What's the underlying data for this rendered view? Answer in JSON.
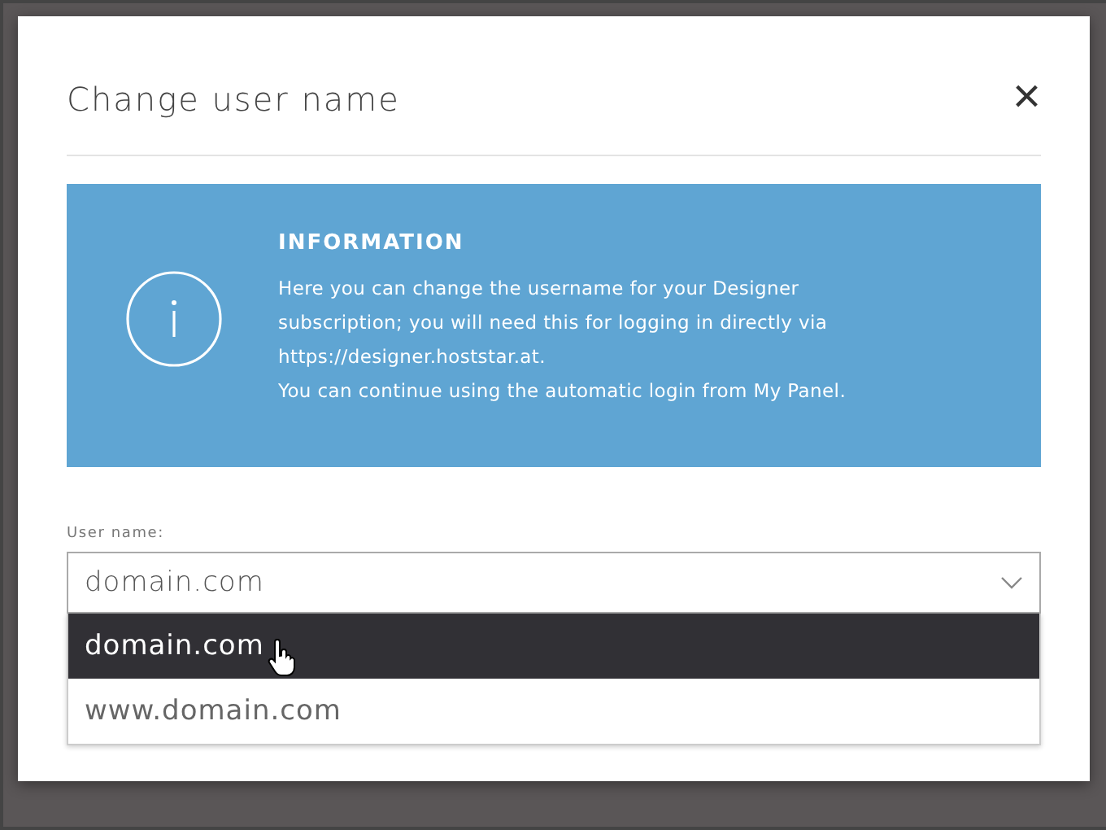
{
  "dialog": {
    "title": "Change user name",
    "close": "×"
  },
  "info": {
    "heading": "INFORMATION",
    "paragraphs": [
      "Here you can change the username for your Designer subscription; you will need this for logging in directly via https://designer.hoststar.at.",
      "You can continue using the automatic login from My Panel."
    ]
  },
  "field": {
    "label": "User name:",
    "value": "domain.com",
    "expanded": true,
    "options": [
      {
        "label": "domain.com",
        "selected": true
      },
      {
        "label": "www.domain.com",
        "selected": false
      }
    ]
  }
}
